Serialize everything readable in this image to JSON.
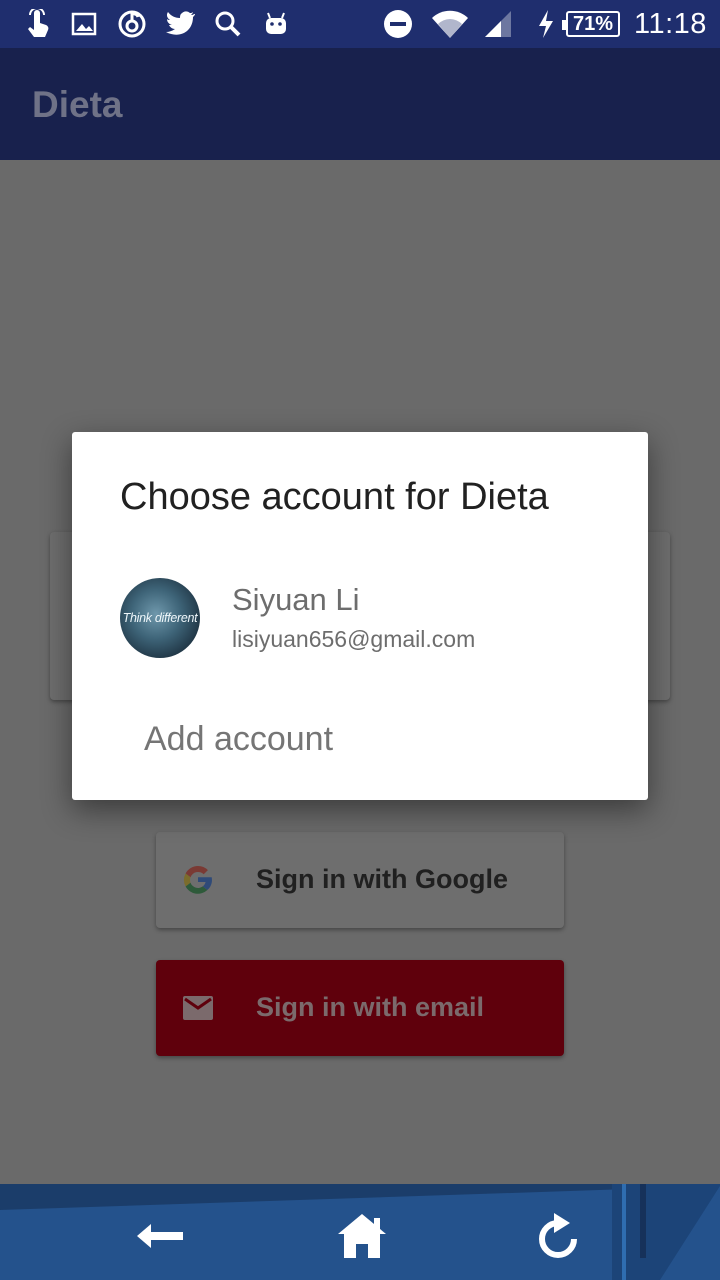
{
  "status_bar": {
    "icons": [
      "touch-icon",
      "gallery-icon",
      "netease-music-icon",
      "twitter-icon",
      "search-icon",
      "android-icon",
      "do-not-disturb-icon",
      "wifi-icon",
      "cell-signal-icon",
      "charging-icon"
    ],
    "battery": "71%",
    "time": "11:18"
  },
  "app_bar": {
    "title": "Dieta"
  },
  "dialog": {
    "title": "Choose account for Dieta",
    "account": {
      "name": "Siyuan Li",
      "email": "lisiyuan656@gmail.com",
      "avatar_text": "Think different"
    },
    "add_account": "Add account"
  },
  "buttons": {
    "google": "Sign in with Google",
    "email": "Sign in with email"
  },
  "nav_bar": {
    "icons": [
      "back-arrow-icon",
      "home-icon",
      "refresh-icon"
    ]
  },
  "colors": {
    "status_bar": "#1f2e6e",
    "scrim": "#6a6a6a",
    "email_button": "#5f000c",
    "nav_bar": "#24528c"
  }
}
